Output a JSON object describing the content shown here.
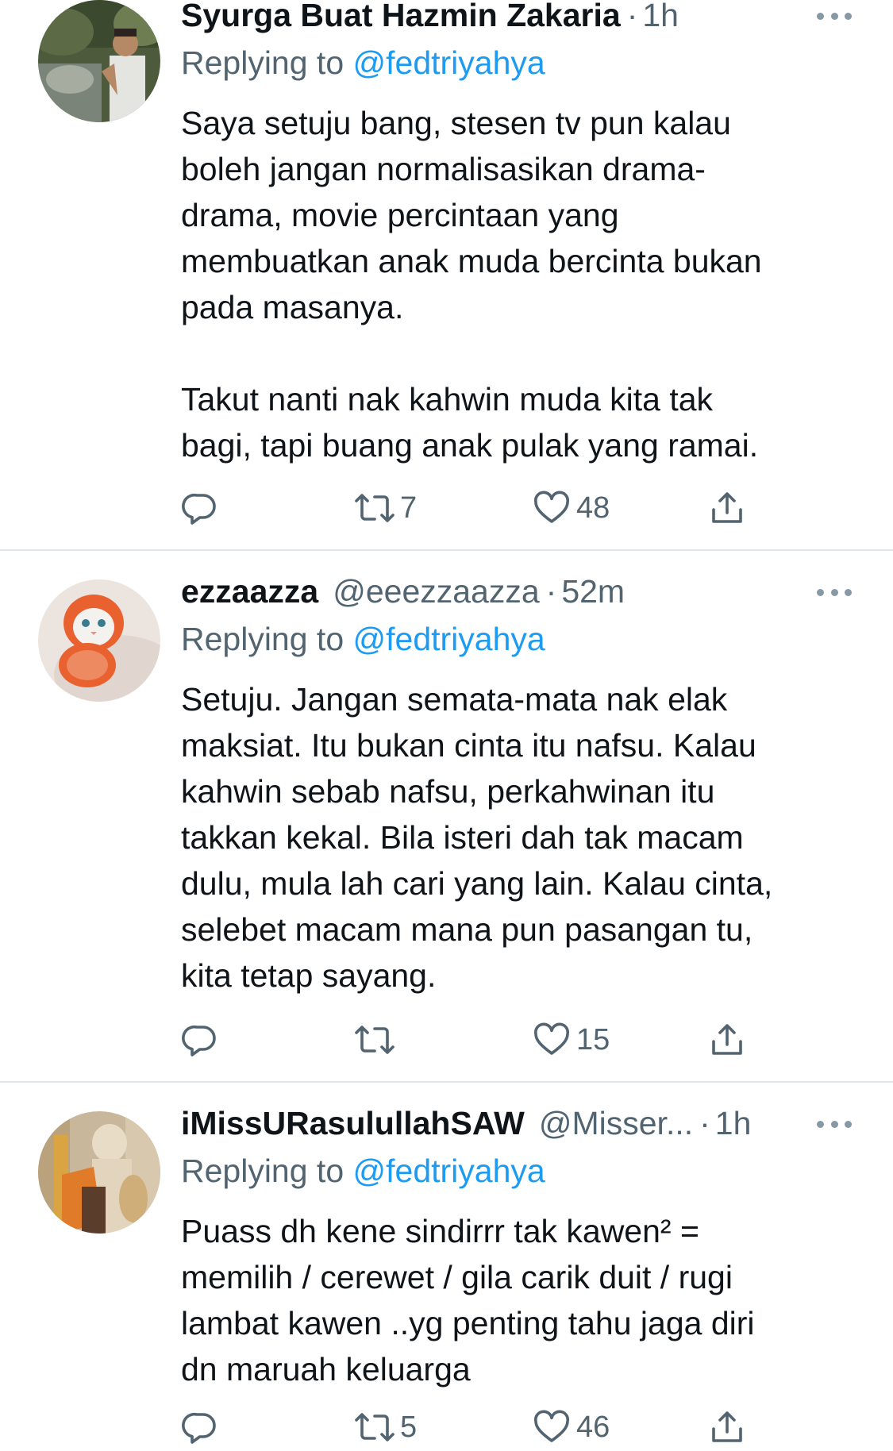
{
  "tweets": [
    {
      "display_name": "Syurga Buat Hazmin Zakaria",
      "handle": "",
      "separator": "·",
      "time": "1h",
      "replying_prefix": "Replying to ",
      "replying_to": "@fedtriyahya",
      "text": "Saya setuju bang, stesen tv pun kalau\nboleh jangan normalisasikan drama-\ndrama, movie percintaan yang\nmembuatkan anak muda bercinta bukan\npada masanya.\n\nTakut nanti nak kahwin muda kita tak\nbagi, tapi buang anak pulak yang ramai.",
      "retweets": "7",
      "likes": "48",
      "reply_count": ""
    },
    {
      "display_name": "ezzaazza",
      "handle": "@eeezzaazza",
      "separator": "·",
      "time": "52m",
      "replying_prefix": "Replying to ",
      "replying_to": "@fedtriyahya",
      "text": "Setuju. Jangan semata-mata nak elak\nmaksiat. Itu bukan cinta itu nafsu. Kalau\nkahwin sebab nafsu, perkahwinan itu\ntakkan kekal. Bila isteri dah tak macam\ndulu, mula lah cari yang lain. Kalau cinta,\nselebet macam mana pun pasangan tu,\nkita tetap sayang.",
      "retweets": "",
      "likes": "15",
      "reply_count": ""
    },
    {
      "display_name": "iMissURasulullahSAW",
      "handle": "@Misser...",
      "separator": "·",
      "time": "1h",
      "replying_prefix": "Replying to ",
      "replying_to": "@fedtriyahya",
      "text": "Puass dh kene sindirrr tak kawen² =\nmemilih / cerewet / gila carik duit / rugi\nlambat kawen ..yg penting tahu jaga diri\ndn maruah keluarga",
      "retweets": "5",
      "likes": "46",
      "reply_count": ""
    }
  ],
  "icons": {
    "reply": "reply-icon",
    "retweet": "retweet-icon",
    "like": "heart-icon",
    "share": "share-icon",
    "more": "more-icon"
  },
  "colors": {
    "text": "#0f1419",
    "secondary": "#536471",
    "link": "#1d9bf0",
    "divider": "#e1e6ea"
  }
}
